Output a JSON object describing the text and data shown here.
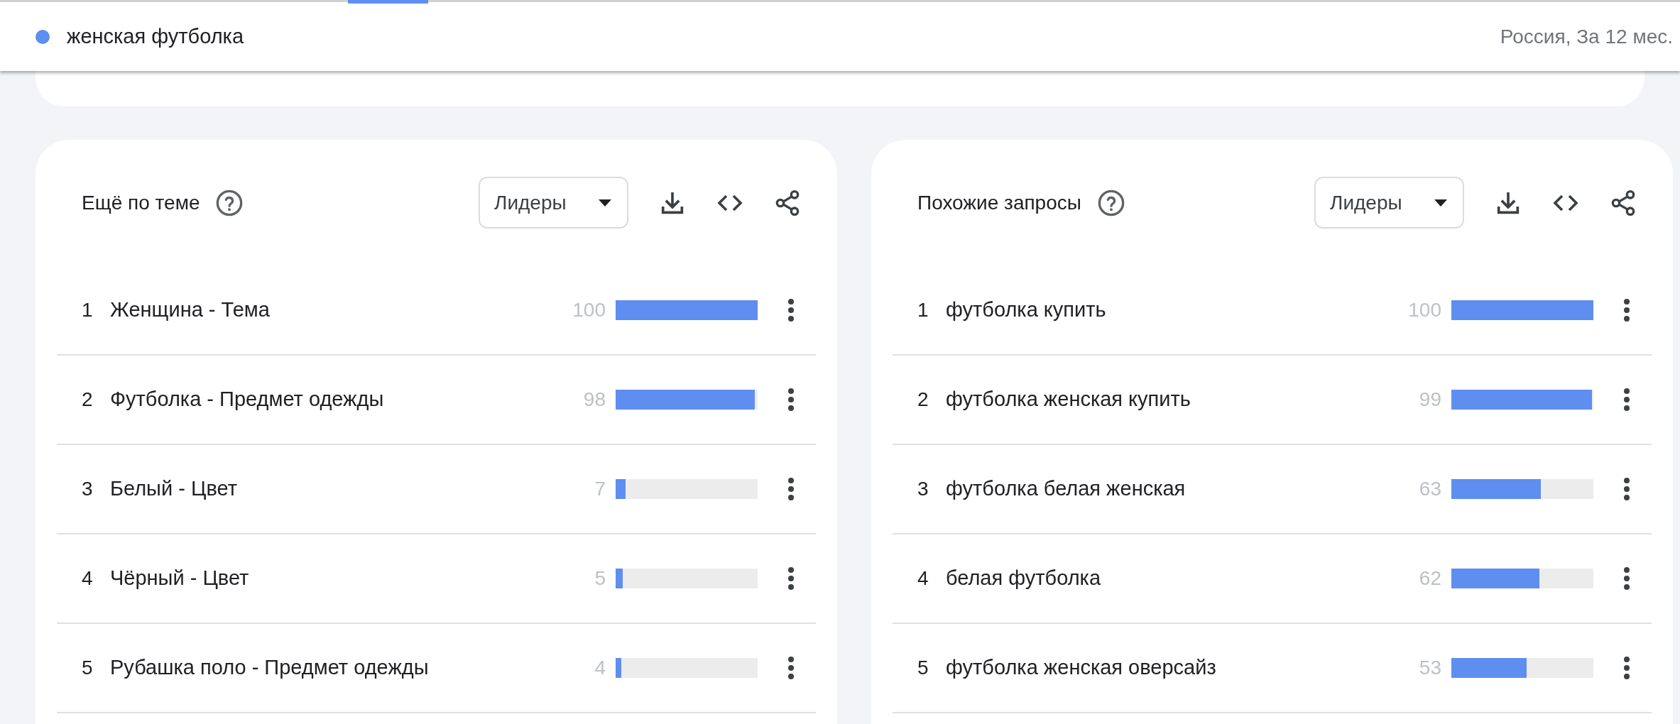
{
  "search_bar": {
    "term": {
      "label": "женская футболка",
      "color": "#5e8ef0"
    },
    "scope": "Россия, За 12 мес."
  },
  "panels": [
    {
      "title": "Ещё по теме",
      "filter": "Лидеры",
      "rows": [
        {
          "rank": "1",
          "label": "Женщина - Тема",
          "value": "100",
          "level": 1.0
        },
        {
          "rank": "2",
          "label": "Футболка - Предмет одежды",
          "value": "98",
          "level": 0.98
        },
        {
          "rank": "3",
          "label": "Белый - Цвет",
          "value": "7",
          "level": 0.07
        },
        {
          "rank": "4",
          "label": "Чёрный - Цвет",
          "value": "5",
          "level": 0.05
        },
        {
          "rank": "5",
          "label": "Рубашка поло - Предмет одежды",
          "value": "4",
          "level": 0.04
        }
      ]
    },
    {
      "title": "Похожие запросы",
      "filter": "Лидеры",
      "rows": [
        {
          "rank": "1",
          "label": "футболка купить",
          "value": "100",
          "level": 1.0
        },
        {
          "rank": "2",
          "label": "футболка женская купить",
          "value": "99",
          "level": 0.99
        },
        {
          "rank": "3",
          "label": "футболка белая женская",
          "value": "63",
          "level": 0.63
        },
        {
          "rank": "4",
          "label": "белая футболка",
          "value": "62",
          "level": 0.62
        },
        {
          "rank": "5",
          "label": "футболка женская оверсайз",
          "value": "53",
          "level": 0.53
        }
      ]
    }
  ]
}
